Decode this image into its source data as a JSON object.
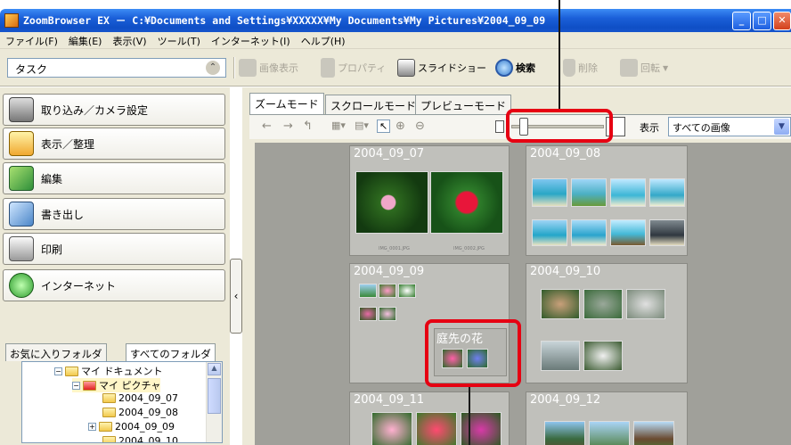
{
  "window": {
    "title": "ZoomBrowser EX － C:¥Documents and Settings¥XXXXX¥My Documents¥My Pictures¥2004_09_09",
    "min": "_",
    "max": "□",
    "close": "✕"
  },
  "menu": [
    "ファイル(F)",
    "編集(E)",
    "表示(V)",
    "ツール(T)",
    "インターネット(I)",
    "ヘルプ(H)"
  ],
  "task": {
    "label": "タスク",
    "chevron": "⌃"
  },
  "toolbar": {
    "view_image": "画像表示",
    "properties": "プロパティ",
    "slideshow": "スライドショー",
    "search": "検索",
    "delete": "削除",
    "rotate": "回転"
  },
  "tasks": [
    "取り込み／カメラ設定",
    "表示／整理",
    "編集",
    "書き出し",
    "印刷",
    "インターネット"
  ],
  "fav_tabs": [
    "お気に入りフォルダ",
    "すべてのフォルダ"
  ],
  "tree": [
    "マイ ドキュメント",
    "マイ ピクチャ",
    "2004_09_07",
    "2004_09_08",
    "2004_09_09",
    "2004_09_10"
  ],
  "mode_tabs": [
    "ズームモード",
    "スクロールモード",
    "プレビューモード"
  ],
  "view": {
    "show_label": "表示",
    "show_value": "すべての画像",
    "zoom_level": 0.1
  },
  "folders": {
    "f1": {
      "name": "2004_09_07",
      "captions": [
        "IMG_0001.JPG",
        "IMG_0002.JPG"
      ]
    },
    "f2": {
      "name": "2004_09_08"
    },
    "f3": {
      "name": "2004_09_09",
      "subfolder": "庭先の花"
    },
    "f4": {
      "name": "2004_09_10"
    },
    "f5": {
      "name": "2004_09_11"
    },
    "f6": {
      "name": "2004_09_12"
    }
  },
  "colors": {
    "titlebar": "#0f4fc6",
    "callout": "#e60012",
    "grid_bg": "#a0a09a"
  }
}
